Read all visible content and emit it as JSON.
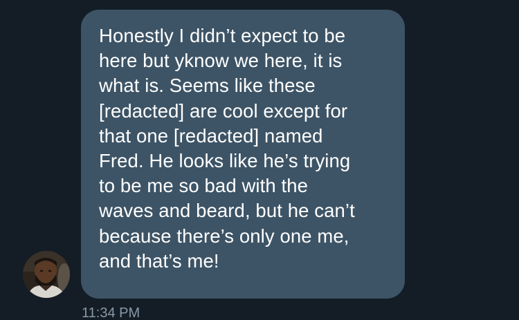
{
  "conversation": {
    "message": {
      "lines": [
        "Honestly I didn’t expect to be",
        "here but yknow we here, it is",
        "what is. Seems like these",
        "[redacted] are cool except for",
        "that one [redacted] named",
        "Fred. He looks like he’s trying",
        "to be me so bad with the",
        "waves and beard, but he can’t",
        "because there’s only one me,",
        "and that’s me!"
      ],
      "timestamp": "11:34 PM"
    },
    "sender": {
      "avatar_icon": "profile-photo"
    }
  },
  "colors": {
    "background": "#141d26",
    "bubble": "#3d5466",
    "text": "#ffffff",
    "timestamp": "#8899a6"
  }
}
